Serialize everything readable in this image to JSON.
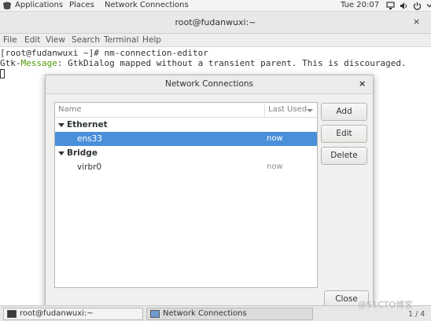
{
  "topbar": {
    "applications": "Applications",
    "places": "Places",
    "active_app": "Network Connections",
    "clock": "Tue 20:07"
  },
  "terminal": {
    "title": "root@fudanwuxi:~",
    "close_label": "×",
    "menu": [
      "File",
      "Edit",
      "View",
      "Search",
      "Terminal",
      "Help"
    ],
    "prompt_line": "[root@fudanwuxi ~]# nm-connection-editor",
    "warning_prefix": "Gtk-",
    "warning_keyword": "Message",
    "warning_text": ": GtkDialog mapped without a transient parent. This is discouraged."
  },
  "dialog": {
    "title": "Network Connections",
    "close_label": "×",
    "columns": {
      "name": "Name",
      "last_used": "Last Used"
    },
    "groups": [
      {
        "label": "Ethernet",
        "connections": [
          {
            "name": "ens33",
            "last_used": "now",
            "selected": true
          }
        ]
      },
      {
        "label": "Bridge",
        "connections": [
          {
            "name": "virbr0",
            "last_used": "now",
            "selected": false
          }
        ]
      }
    ],
    "buttons": {
      "add": "Add",
      "edit": "Edit",
      "delete": "Delete",
      "close": "Close"
    }
  },
  "taskbar": {
    "items": [
      "root@fudanwuxi:~",
      "Network Connections"
    ],
    "pager": "1 / 4"
  },
  "watermark": "@51CTO博客",
  "colors": {
    "selection": "#4a90d9",
    "gtk_message": "#4e9a06"
  }
}
